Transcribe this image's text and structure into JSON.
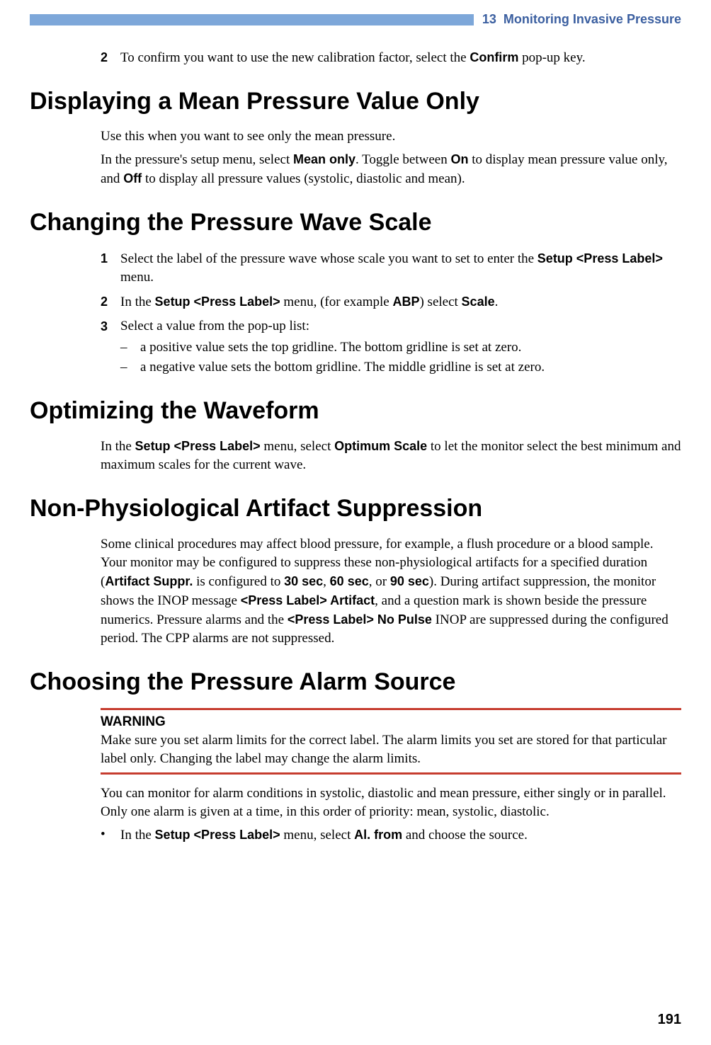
{
  "header": {
    "chapter_num": "13",
    "chapter_title": "Monitoring Invasive Pressure"
  },
  "page_number": "191",
  "intro_step": {
    "num": "2",
    "pre": "To confirm you want to use the new calibration factor, select the ",
    "key": "Confirm",
    "post": " pop-up key."
  },
  "sec1": {
    "title": "Displaying a Mean Pressure Value Only",
    "p1": "Use this when you want to see only the mean pressure.",
    "p2_a": "In the pressure's setup menu, select ",
    "p2_key1": "Mean only",
    "p2_b": ". Toggle between ",
    "p2_key2": "On",
    "p2_c": " to display mean pressure value only, and ",
    "p2_key3": "Off",
    "p2_d": " to display all pressure values (systolic, diastolic and mean)."
  },
  "sec2": {
    "title": "Changing the Pressure Wave Scale",
    "s1": {
      "num": "1",
      "a": "Select the label of the pressure wave whose scale you want to set to enter the ",
      "k1": "Setup <Press Label>",
      "b": " menu."
    },
    "s2": {
      "num": "2",
      "a": "In the ",
      "k1": "Setup <Press Label>",
      "b": " menu, (for example ",
      "k2": "ABP",
      "c": ") select ",
      "k3": "Scale",
      "d": "."
    },
    "s3": {
      "num": "3",
      "a": "Select a value from the pop-up list:",
      "sub1": "a positive value sets the top gridline. The bottom gridline is set at zero.",
      "sub2": "a negative value sets the bottom gridline. The middle gridline is set at zero."
    }
  },
  "sec3": {
    "title": "Optimizing the Waveform",
    "p_a": "In the ",
    "k1": "Setup <Press Label>",
    "p_b": " menu, select ",
    "k2": "Optimum Scale",
    "p_c": " to let the monitor select the best minimum and maximum scales for the current wave."
  },
  "sec4": {
    "title": "Non-Physiological Artifact Suppression",
    "a": "Some clinical procedures may affect blood pressure, for example, a flush procedure or a blood sample. Your monitor may be configured to suppress these non-physiological artifacts for a specified duration (",
    "k1": "Artifact Suppr.",
    "b": " is configured to ",
    "k2": "30 sec",
    "c": ", ",
    "k3": "60 sec",
    "d": ", or ",
    "k4": "90 sec",
    "e": "). During artifact suppression, the monitor shows the INOP message ",
    "k5": "<Press Label> Artifact",
    "f": ", and a question mark is shown beside the pressure numerics. Pressure alarms and the ",
    "k6": "<Press Label> No Pulse",
    "g": " INOP are suppressed during the configured period. The CPP alarms are not suppressed."
  },
  "sec5": {
    "title": "Choosing the Pressure Alarm Source",
    "warn_head": "WARNING",
    "warn_body": "Make sure you set alarm limits for the correct label. The alarm limits you set are stored for that particular label only. Changing the label may change the alarm limits.",
    "p1": "You can monitor for alarm conditions in systolic, diastolic and mean pressure, either singly or in parallel. Only one alarm is given at a time, in this order of priority: mean, systolic, diastolic.",
    "bullet": {
      "a": "In the ",
      "k1": "Setup <Press Label>",
      "b": " menu, select ",
      "k2": "Al. from",
      "c": " and choose the source."
    }
  }
}
